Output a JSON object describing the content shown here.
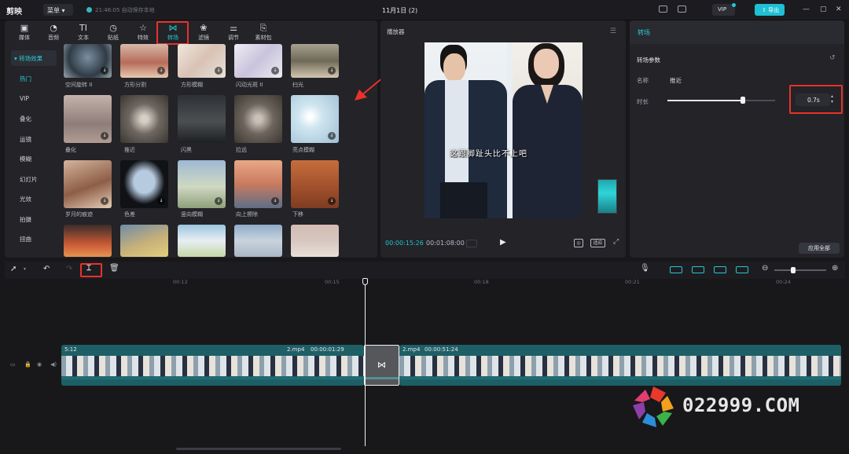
{
  "app": {
    "logo": "剪映",
    "menu": "菜单",
    "autosave": "21:46:05 自动保存本地",
    "title": "11月1日 (2)",
    "vip": "VIP",
    "export": "导出"
  },
  "tabs": [
    {
      "label": "媒体",
      "icon": "media-icon"
    },
    {
      "label": "音频",
      "icon": "audio-icon"
    },
    {
      "label": "文本",
      "icon": "text-icon"
    },
    {
      "label": "贴纸",
      "icon": "sticker-icon"
    },
    {
      "label": "特效",
      "icon": "effects-icon"
    },
    {
      "label": "转场",
      "icon": "transition-icon",
      "active": true
    },
    {
      "label": "滤镜",
      "icon": "filter-icon"
    },
    {
      "label": "调节",
      "icon": "adjust-icon"
    },
    {
      "label": "素材包",
      "icon": "package-icon"
    }
  ],
  "categories": [
    "转场效果",
    "热门",
    "VIP",
    "叠化",
    "运镜",
    "模糊",
    "幻灯片",
    "光效",
    "拍摄",
    "扭曲"
  ],
  "effects": [
    "空间旋转 II",
    "方形分割",
    "方形模糊",
    "闪动光斑 II",
    "扫光",
    "叠化",
    "推近",
    "闪黑",
    "拉远",
    "亮点模糊",
    "岁月的痕迹",
    "色差",
    "竖向模糊",
    "向上擦除",
    "下移",
    "",
    "",
    "",
    "",
    ""
  ],
  "player": {
    "title": "播放器",
    "subtitle": "这跟脚趾头比不上吧",
    "current_time": "00:00:15:26",
    "total_time": "00:01:08:00",
    "ratio_label": "适应"
  },
  "attributes": {
    "header": "转场",
    "section": "转场参数",
    "name_label": "名称",
    "name_value": "推近",
    "duration_label": "时长",
    "duration_value": "0.7s",
    "duration_fraction": 0.7,
    "apply_all": "应用全部"
  },
  "timeline": {
    "ruler": [
      "00:12",
      "00:15",
      "00:18",
      "00:21",
      "00:24"
    ],
    "clip1_label_left": "5:12",
    "clip1_name": "2.mp4",
    "clip1_duration": "00:00:01:29",
    "clip2_name": "2.mp4",
    "clip2_duration": "00:00:51:24"
  },
  "watermark": "022999.COM"
}
